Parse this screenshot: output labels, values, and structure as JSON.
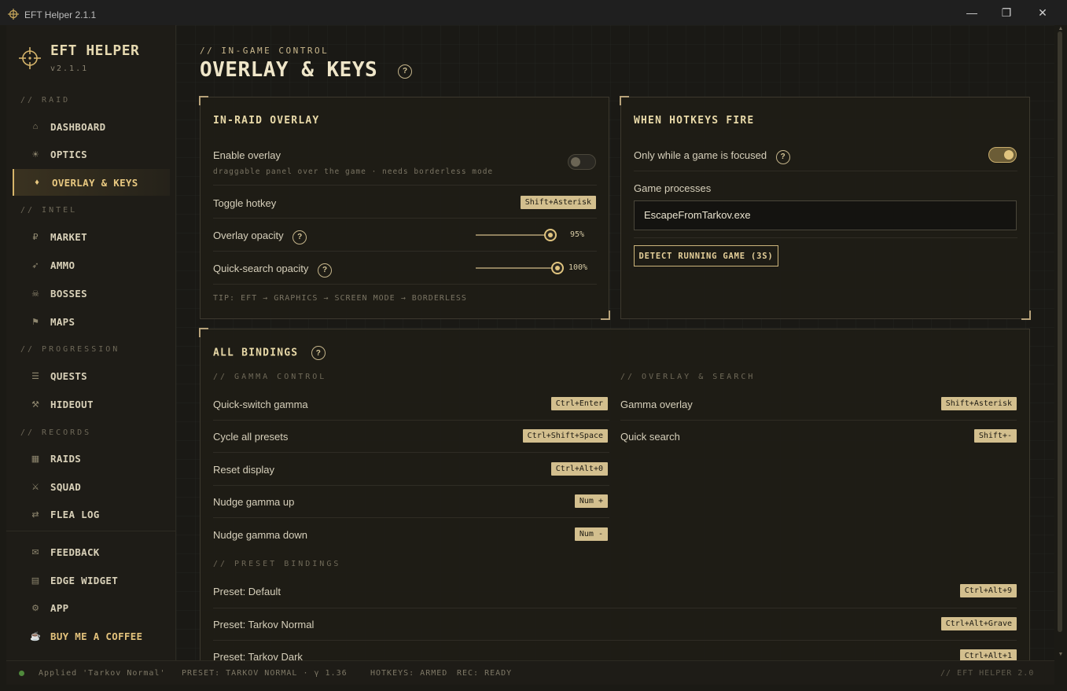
{
  "window": {
    "title": "EFT Helper 2.1.1",
    "minimize": "—",
    "maximize": "❐",
    "close": "✕"
  },
  "brand": {
    "name": "EFT HELPER",
    "version": "v2.1.1"
  },
  "sidebar": {
    "sections": [
      "// RAID",
      "// INTEL",
      "// PROGRESSION",
      "// RECORDS"
    ],
    "items": [
      {
        "label": "DASHBOARD",
        "icon": "⌂"
      },
      {
        "label": "OPTICS",
        "icon": "☀"
      },
      {
        "label": "OVERLAY & KEYS",
        "icon": "♦"
      },
      {
        "label": "MARKET",
        "icon": "₽"
      },
      {
        "label": "AMMO",
        "icon": "➶"
      },
      {
        "label": "BOSSES",
        "icon": "☠"
      },
      {
        "label": "MAPS",
        "icon": "⚑"
      },
      {
        "label": "QUESTS",
        "icon": "☰"
      },
      {
        "label": "HIDEOUT",
        "icon": "⚒"
      },
      {
        "label": "RAIDS",
        "icon": "▦"
      },
      {
        "label": "SQUAD",
        "icon": "⚔"
      },
      {
        "label": "FLEA LOG",
        "icon": "⇄"
      }
    ],
    "footer_items": [
      {
        "label": "FEEDBACK",
        "icon": "✉"
      },
      {
        "label": "EDGE WIDGET",
        "icon": "▤"
      },
      {
        "label": "APP",
        "icon": "⚙"
      },
      {
        "label": "BUY ME A COFFEE",
        "icon": "☕"
      }
    ],
    "active_color": "#e8c880"
  },
  "page": {
    "eyebrow": "// IN-GAME CONTROL",
    "title": "OVERLAY & KEYS",
    "help": "?"
  },
  "overlay_card": {
    "title": "IN-RAID OVERLAY",
    "enable_label": "Enable overlay",
    "enable_sub": "draggable panel over the game · needs borderless mode",
    "enable_on": false,
    "toggle_hotkey_label": "Toggle hotkey",
    "toggle_hotkey": "Shift+Asterisk",
    "opacity_label": "Overlay opacity",
    "opacity_value": 95,
    "opacity_text": "95%",
    "qs_opacity_label": "Quick-search opacity",
    "qs_opacity_value": 100,
    "qs_opacity_text": "100%",
    "tip": "TIP: EFT → GRAPHICS → SCREEN MODE → BORDERLESS"
  },
  "hotkeys_card": {
    "title": "WHEN HOTKEYS FIRE",
    "focused_label": "Only while a game is focused",
    "focused_on": true,
    "processes_label": "Game processes",
    "processes_value": "EscapeFromTarkov.exe",
    "detect_button": "DETECT RUNNING GAME (3S)"
  },
  "bindings_card": {
    "title": "ALL BINDINGS",
    "gamma_section": "// GAMMA CONTROL",
    "overlay_section": "// OVERLAY & SEARCH",
    "preset_section": "// PRESET BINDINGS",
    "gamma": [
      {
        "label": "Quick-switch gamma",
        "key": "Ctrl+Enter"
      },
      {
        "label": "Cycle all presets",
        "key": "Ctrl+Shift+Space"
      },
      {
        "label": "Reset display",
        "key": "Ctrl+Alt+0"
      },
      {
        "label": "Nudge gamma up",
        "key": "Num +"
      },
      {
        "label": "Nudge gamma down",
        "key": "Num -"
      }
    ],
    "overlay": [
      {
        "label": "Gamma overlay",
        "key": "Shift+Asterisk"
      },
      {
        "label": "Quick search",
        "key": "Shift+-"
      }
    ],
    "presets": [
      {
        "label": "Preset: Default",
        "key": "Ctrl+Alt+9"
      },
      {
        "label": "Preset: Tarkov Normal",
        "key": "Ctrl+Alt+Grave"
      },
      {
        "label": "Preset: Tarkov Dark",
        "key": "Ctrl+Alt+1"
      }
    ]
  },
  "status": {
    "applied": "Applied 'Tarkov Normal'",
    "preset": "PRESET: TARKOV NORMAL · γ 1.36",
    "hotkeys": "HOTKEYS: ARMED",
    "rec": "REC: READY",
    "right": "// EFT HELPER 2.0"
  }
}
